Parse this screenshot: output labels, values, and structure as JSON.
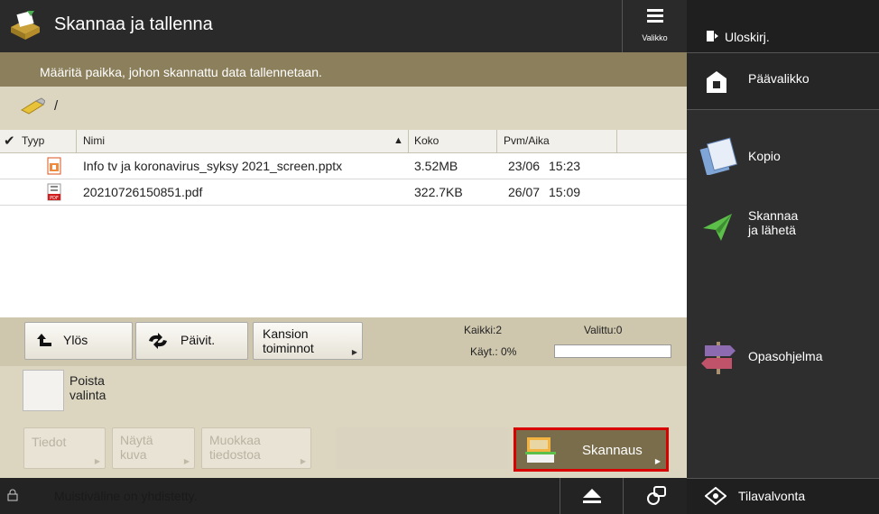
{
  "title": "Skannaa ja tallenna",
  "menu_label": "Valikko",
  "instruction": "Määritä paikka, johon skannattu data tallennetaan.",
  "path": "/",
  "columns": {
    "type": "Tyyp",
    "name": "Nimi",
    "size": "Koko",
    "date": "Pvm/Aika"
  },
  "files": [
    {
      "name": "Info tv ja koronavirus_syksy 2021_screen.pptx",
      "size": "3.52MB",
      "date": "23/06",
      "time": "15:23",
      "icon": "pptx-file-icon"
    },
    {
      "name": "20210726150851.pdf",
      "size": "322.7KB",
      "date": "26/07",
      "time": "15:09",
      "icon": "pdf-file-icon"
    }
  ],
  "toolbar": {
    "up": "Ylös",
    "refresh": "Päivit.",
    "folder_ops_1": "Kansion",
    "folder_ops_2": "toiminnot"
  },
  "counts": {
    "all": "Kaikki:2",
    "selected": "Valittu:0",
    "used": "Käyt.: 0%",
    "usage_fraction": 0
  },
  "deselect_1": "Poista",
  "deselect_2": "valinta",
  "actions": {
    "info": "Tiedot",
    "preview_1": "Näytä",
    "preview_2": "kuva",
    "edit_1": "Muokkaa",
    "edit_2": "tiedostoa",
    "scan": "Skannaus"
  },
  "status_message": "Muistiväline on yhdistetty.",
  "side": {
    "logout": "Uloskirj.",
    "home": "Päävalikko",
    "copy": "Kopio",
    "scan_send_1": "Skannaa",
    "scan_send_2": "ja lähetä",
    "guide": "Opasohjelma",
    "status_monitor": "Tilavalvonta"
  },
  "colors": {
    "accent": "#8c7f5c",
    "highlight": "#d90000",
    "panel": "#2e2e2e"
  }
}
